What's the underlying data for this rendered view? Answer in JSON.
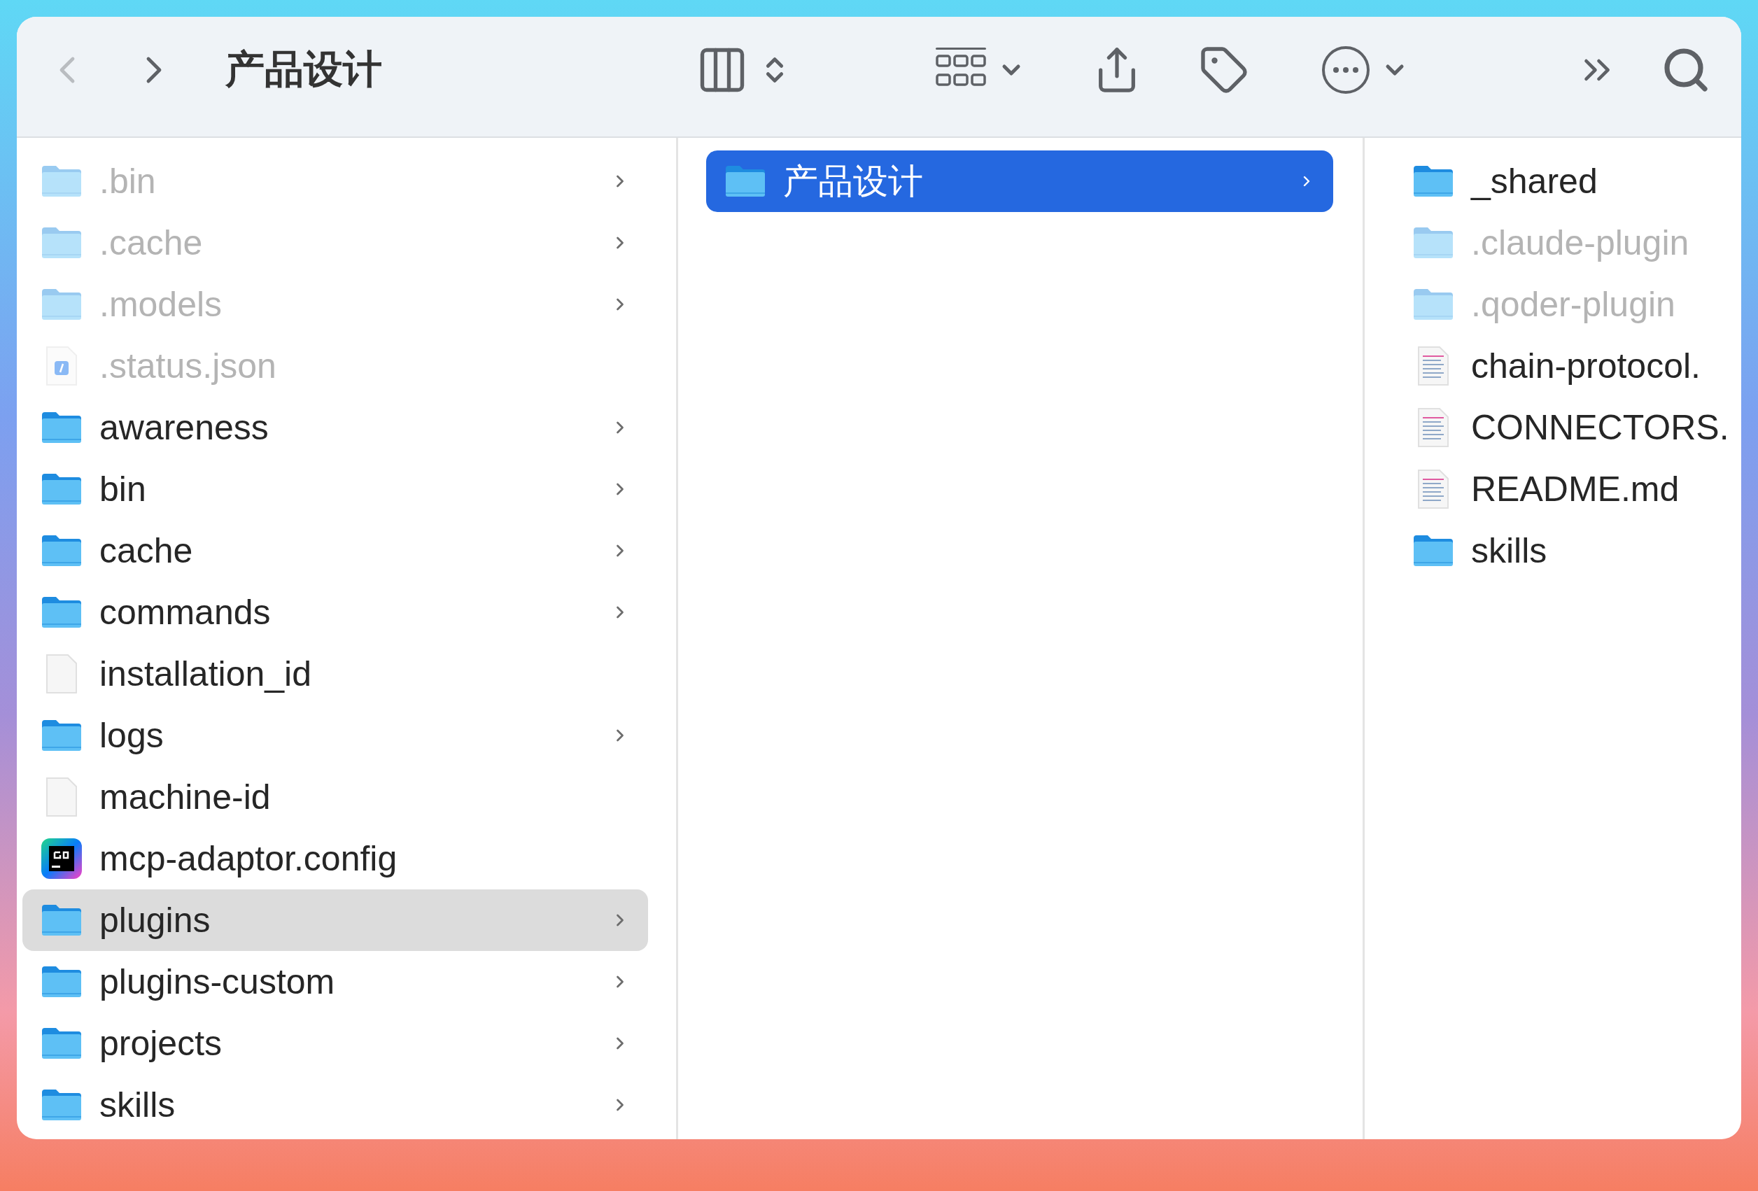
{
  "toolbar": {
    "back": {
      "disabled": true
    },
    "forward": {
      "disabled": false
    },
    "title": "产品设计"
  },
  "columns": [
    {
      "items": [
        {
          "name": ".bin",
          "kind": "folder",
          "hidden": true,
          "has_children": true,
          "selected": false
        },
        {
          "name": ".cache",
          "kind": "folder",
          "hidden": true,
          "has_children": true,
          "selected": false
        },
        {
          "name": ".models",
          "kind": "folder",
          "hidden": true,
          "has_children": true,
          "selected": false
        },
        {
          "name": ".status.json",
          "kind": "json",
          "hidden": true,
          "has_children": false,
          "selected": false
        },
        {
          "name": "awareness",
          "kind": "folder",
          "hidden": false,
          "has_children": true,
          "selected": false
        },
        {
          "name": "bin",
          "kind": "folder",
          "hidden": false,
          "has_children": true,
          "selected": false
        },
        {
          "name": "cache",
          "kind": "folder",
          "hidden": false,
          "has_children": true,
          "selected": false
        },
        {
          "name": "commands",
          "kind": "folder",
          "hidden": false,
          "has_children": true,
          "selected": false
        },
        {
          "name": "installation_id",
          "kind": "file",
          "hidden": false,
          "has_children": false,
          "selected": false
        },
        {
          "name": "logs",
          "kind": "folder",
          "hidden": false,
          "has_children": true,
          "selected": false
        },
        {
          "name": "machine-id",
          "kind": "file",
          "hidden": false,
          "has_children": false,
          "selected": false
        },
        {
          "name": "mcp-adaptor.config",
          "kind": "app",
          "hidden": false,
          "has_children": false,
          "selected": false
        },
        {
          "name": "plugins",
          "kind": "folder",
          "hidden": false,
          "has_children": true,
          "selected": true
        },
        {
          "name": "plugins-custom",
          "kind": "folder",
          "hidden": false,
          "has_children": true,
          "selected": false
        },
        {
          "name": "projects",
          "kind": "folder",
          "hidden": false,
          "has_children": true,
          "selected": false
        },
        {
          "name": "skills",
          "kind": "folder",
          "hidden": false,
          "has_children": true,
          "selected": false
        }
      ]
    },
    {
      "items": [
        {
          "name": "产品设计",
          "kind": "folder",
          "hidden": false,
          "has_children": true,
          "selected": true
        }
      ]
    },
    {
      "items": [
        {
          "name": "_shared",
          "kind": "folder",
          "hidden": false,
          "has_children": false,
          "selected": false
        },
        {
          "name": ".claude-plugin",
          "kind": "folder",
          "hidden": true,
          "has_children": false,
          "selected": false
        },
        {
          "name": ".qoder-plugin",
          "kind": "folder",
          "hidden": true,
          "has_children": false,
          "selected": false
        },
        {
          "name": "chain-protocol.",
          "kind": "text",
          "hidden": false,
          "has_children": false,
          "selected": false
        },
        {
          "name": "CONNECTORS.",
          "kind": "text",
          "hidden": false,
          "has_children": false,
          "selected": false
        },
        {
          "name": "README.md",
          "kind": "text",
          "hidden": false,
          "has_children": false,
          "selected": false
        },
        {
          "name": "skills",
          "kind": "folder",
          "hidden": false,
          "has_children": false,
          "selected": false
        }
      ]
    }
  ]
}
